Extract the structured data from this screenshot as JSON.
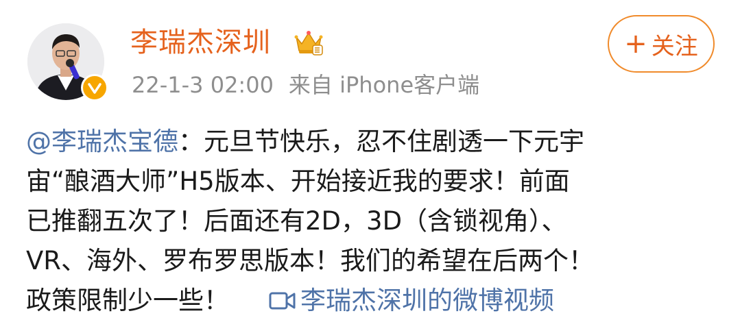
{
  "user": {
    "name": "李瑞杰深圳"
  },
  "meta": {
    "timestamp": "22-1-3 02:00",
    "source_prefix": "来自",
    "source_client": "iPhone客户端"
  },
  "follow_button": {
    "plus": "+",
    "label": "关注"
  },
  "post": {
    "mention": "@李瑞杰宝德",
    "line1_rest": "：元旦节快乐，忍不住剧透一下元宇",
    "line2": "宙“酿酒大师”H5版本、开始接近我的要求！前面",
    "line3": "已推翻五次了！后面还有2D，3D（含锁视角）、",
    "line4": "VR、海外、罗布罗思版本！我们的希望在后两个！",
    "line5": "政策限制少一些！",
    "video_link": "李瑞杰深圳的微博视频"
  },
  "colors": {
    "username": "#e5621d",
    "link": "#4f73a8",
    "meta": "#8e8e8e",
    "follow_border": "#f08a2a",
    "verified_badge": "#f7a600"
  },
  "icons": {
    "crown": "crown-icon",
    "verified": "verified-badge-icon",
    "video": "video-camera-icon"
  }
}
